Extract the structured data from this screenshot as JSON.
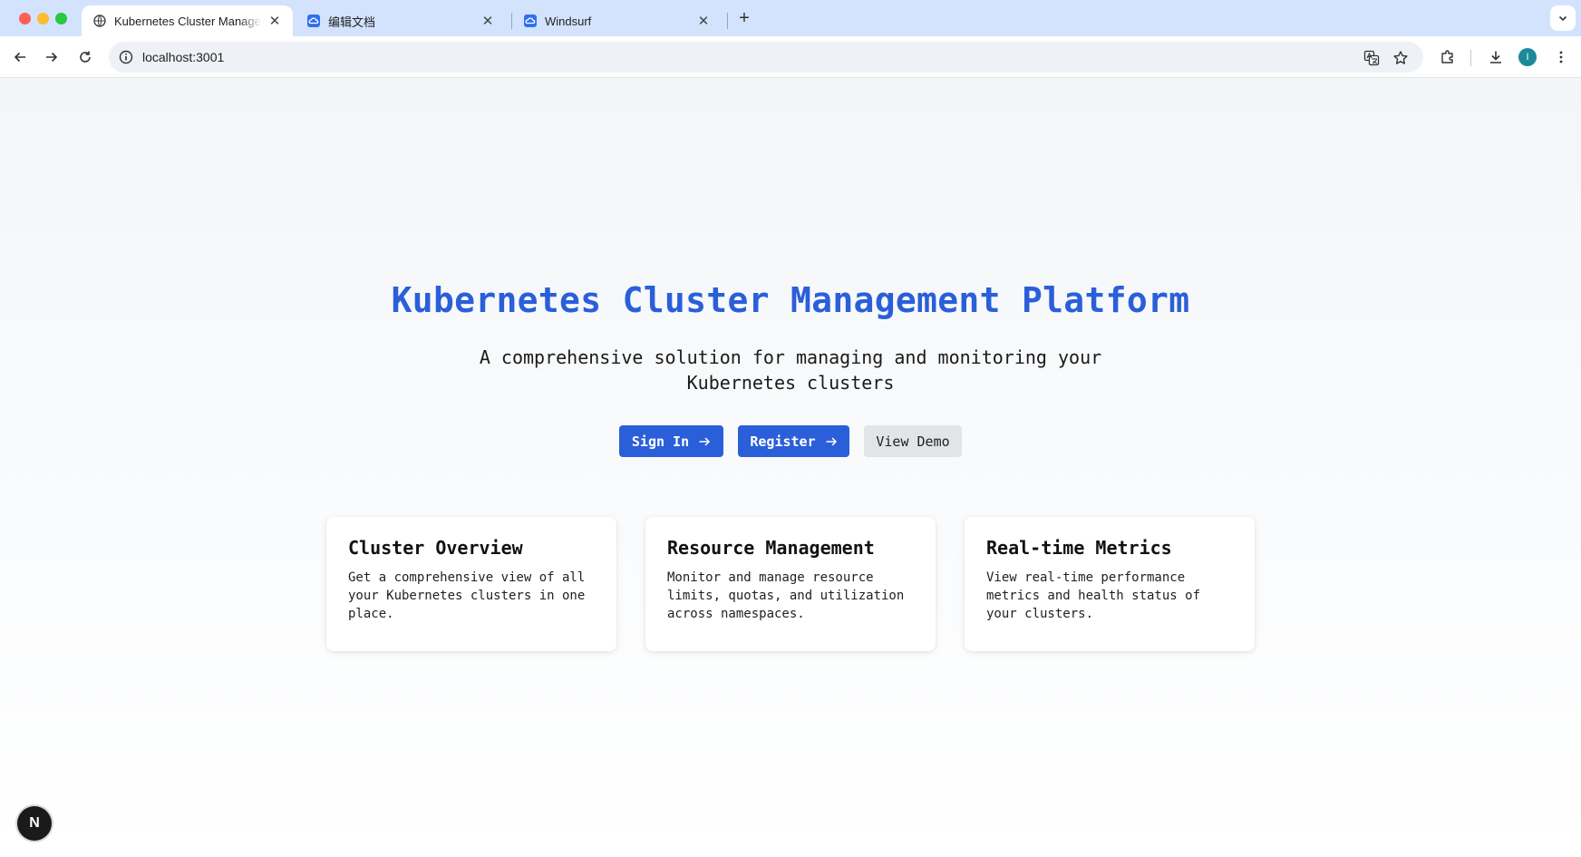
{
  "browser": {
    "tabs": [
      {
        "title": "Kubernetes Cluster Management Platform",
        "icon": "globe-icon",
        "active": true
      },
      {
        "title": "编辑文档",
        "icon": "baidu-cloud-icon",
        "active": false
      },
      {
        "title": "Windsurf",
        "icon": "baidu-cloud-icon",
        "active": false
      }
    ],
    "new_tab_label": "+",
    "address": "localhost:3001",
    "profile_initial": "I",
    "toolbar_icons": [
      "back-icon",
      "forward-icon",
      "reload-icon",
      "info-icon",
      "translate-icon",
      "star-icon",
      "extensions-icon",
      "download-icon",
      "menu-icon"
    ]
  },
  "hero": {
    "title": "Kubernetes Cluster Management Platform",
    "subtitle": "A comprehensive solution for managing and monitoring your Kubernetes clusters"
  },
  "actions": {
    "sign_in": "Sign In",
    "register": "Register",
    "view_demo": "View Demo"
  },
  "features": [
    {
      "title": "Cluster Overview",
      "description": "Get a comprehensive view of all your Kubernetes clusters in one place."
    },
    {
      "title": "Resource Management",
      "description": "Monitor and manage resource limits, quotas, and utilization across namespaces."
    },
    {
      "title": "Real-time Metrics",
      "description": "View real-time performance metrics and health status of your clusters."
    }
  ],
  "dev_badge": "N",
  "colors": {
    "primary": "#2b5fd9",
    "tabstrip": "#d3e3fd",
    "secondary_button": "#e2e4e8"
  }
}
